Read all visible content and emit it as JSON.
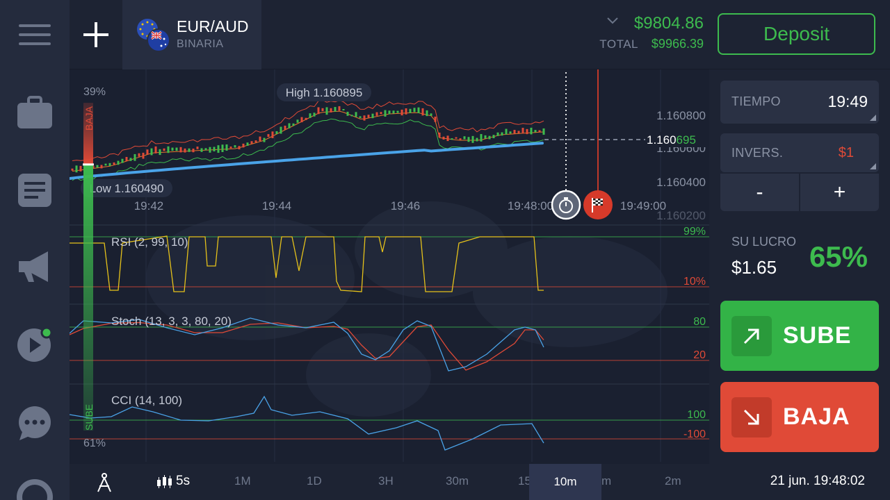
{
  "header": {
    "asset": {
      "name": "EUR/AUD",
      "type": "BINARIA"
    },
    "balance": "$9804.86",
    "total_label": "TOTAL",
    "total_value": "$9966.39",
    "deposit_label": "Deposit"
  },
  "sidebar": {
    "items": [
      {
        "icon": "menu-icon"
      },
      {
        "icon": "briefcase-icon"
      },
      {
        "icon": "document-icon"
      },
      {
        "icon": "megaphone-icon"
      },
      {
        "icon": "play-icon"
      },
      {
        "icon": "chat-icon"
      },
      {
        "icon": "help-icon"
      }
    ]
  },
  "chart": {
    "high_label": "High 1.160895",
    "low_label": "Low 1.160490",
    "price_ticks": [
      "1.160800",
      "1.160600",
      "1.160400",
      "1.160200"
    ],
    "time_ticks": [
      "19:42",
      "19:44",
      "19:46",
      "19:48:00",
      "19:49:00"
    ],
    "current_price_prefix": "1.160",
    "current_price_suffix": "695",
    "sentiment_top": "39%",
    "sentiment_top_label": "BAJA",
    "sentiment_bottom": "61%",
    "sentiment_bottom_label": "SUBE",
    "sentiment_up_fraction": 0.61,
    "rsi": {
      "label": "RSI  (2,  99,  10)",
      "upper": "99%",
      "lower": "10%"
    },
    "stoch": {
      "label": "Stoch  (13,  3,  3,  80,  20)",
      "upper": "80",
      "lower": "20"
    },
    "cci": {
      "label": "CCI  (14,  100)",
      "upper": "100",
      "lower": "-100"
    },
    "colors": {
      "up": "#3dbb4e",
      "down": "#e04a37",
      "ma": "#4aa3e8",
      "rsi": "#e6c21a",
      "stoch_fast": "#4aa3e8",
      "stoch_slow": "#e04a37",
      "cci": "#4aa3e8"
    }
  },
  "toolbar": {
    "timeframes": [
      "5s",
      "1M",
      "1D",
      "3H",
      "30m",
      "15",
      "10m",
      "m",
      "2m"
    ],
    "active_timeframe": "10m",
    "clock": "21 jun. 19:48:02"
  },
  "panel": {
    "time_label": "TIEMPO",
    "time_value": "19:49",
    "invest_label": "INVERS.",
    "invest_value": "$1",
    "minus": "-",
    "plus": "+",
    "profit_label": "SU LUCRO",
    "profit_value": "$1.65",
    "profit_pct": "65%",
    "up_label": "SUBE",
    "down_label": "BAJA"
  }
}
